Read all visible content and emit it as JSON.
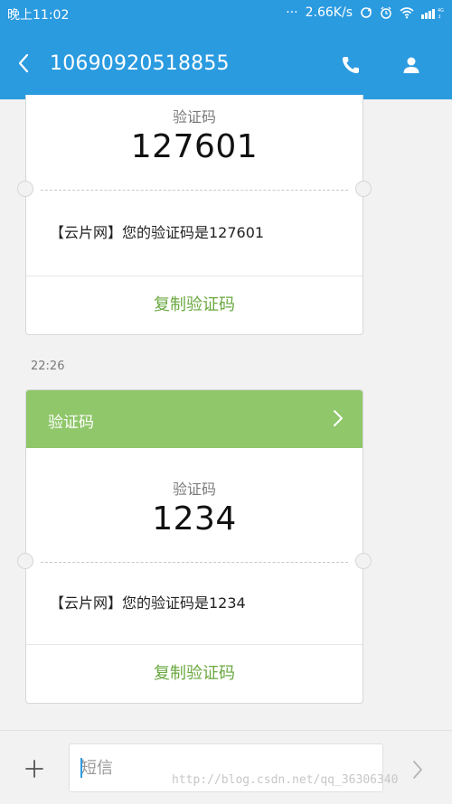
{
  "status_bar": {
    "time": "晚上11:02",
    "network_speed": "2.66K/s",
    "icons": [
      "dots-icon",
      "sync-icon",
      "alarm-icon",
      "wifi-icon",
      "signal-icon"
    ]
  },
  "header": {
    "title": "10690920518855",
    "icons": [
      "back-icon",
      "phone-icon",
      "person-icon"
    ]
  },
  "messages": [
    {
      "code_label": "验证码",
      "code_value": "127601",
      "body": "【云片网】您的验证码是127601",
      "copy_label": "复制验证码"
    },
    {
      "timestamp": "22:26",
      "header_label": "验证码",
      "code_label": "验证码",
      "code_value": "1234",
      "body": "【云片网】您的验证码是1234",
      "copy_label": "复制验证码"
    }
  ],
  "composer": {
    "placeholder": "短信",
    "value": ""
  },
  "watermark": "http://blog.csdn.net/qq_36306340",
  "colors": {
    "primary": "#2b9be0",
    "card_header": "#8fc76a",
    "copy_text": "#6aa840",
    "background": "#f2f2f2"
  }
}
